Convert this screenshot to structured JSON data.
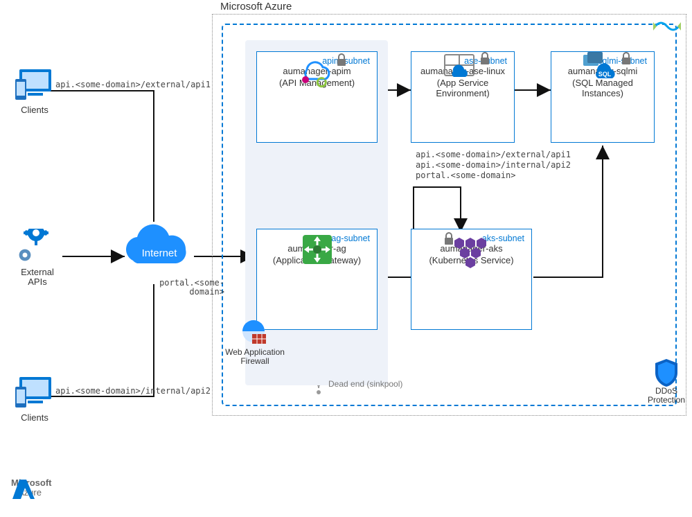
{
  "cloud_boundary": {
    "title": "Microsoft Azure"
  },
  "external": {
    "clients_top": "Clients",
    "clients_bottom": "Clients",
    "external_apis": "External\nAPIs",
    "internet": "Internet"
  },
  "paths": {
    "top": "api.<some-domain>/external/api1",
    "bottom": "api.<some-domain>/internal/api2",
    "portal": "portal.<some-\ndomain>",
    "routes": "api.<some-domain>/external/api1\napi.<some-domain>/internal/api2\nportal.<some-domain>",
    "deadend": "Dead end (sinkpool)"
  },
  "security": {
    "waf": "Web Application\nFirewall",
    "ddos": "DDoS\nProtection"
  },
  "subnets": {
    "ag": {
      "title": "ag-subnet",
      "name": "aumanager-ag",
      "type": "(Application Gateway)"
    },
    "apim": {
      "title": "apim-subnet",
      "name": "aumanager-apim",
      "type": "(API Management)"
    },
    "ase": {
      "title": "ase-subnet",
      "name": "aumanager-ase-linux",
      "type": "(App Service\nEnvironment)"
    },
    "sqlmi": {
      "title": "sqlmi-subnet",
      "name": "aumanager-sqlmi",
      "type": "(SQL Managed\nInstances)"
    },
    "aks": {
      "title": "aks-subnet",
      "name": "aumanager-aks",
      "type": "(Kubernetes Service)"
    }
  },
  "footer": {
    "brand1": "Microsoft",
    "brand2": "Azure"
  }
}
